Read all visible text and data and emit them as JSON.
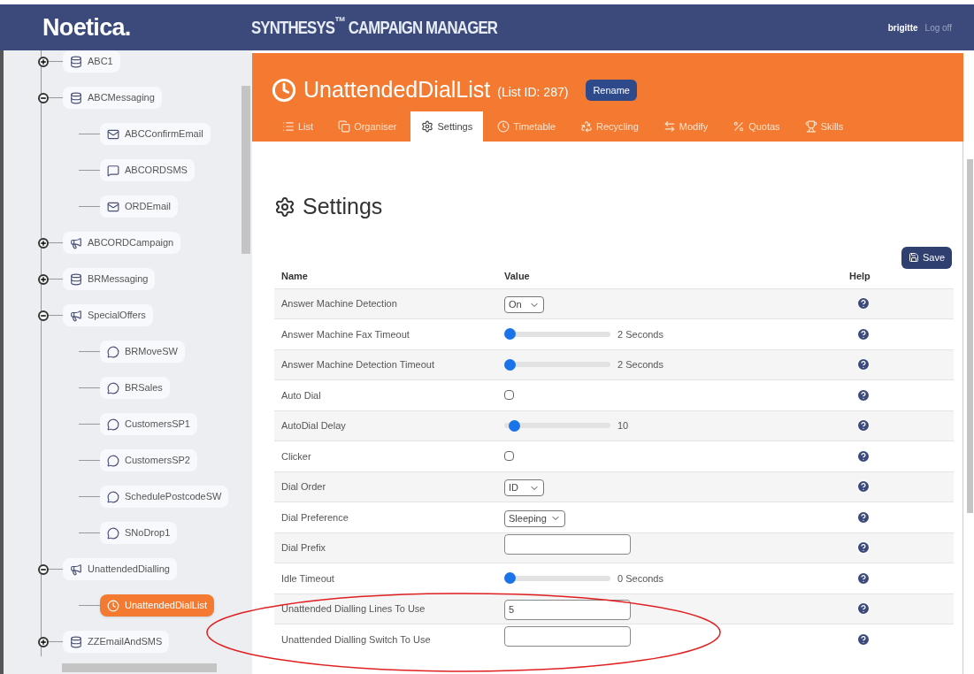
{
  "header": {
    "logo": "Noetica.",
    "product": "SYNTHESYS$^{™}$ CAMPAIGN MANAGER",
    "user": "brigitte",
    "logoff": "Log off"
  },
  "tree": [
    {
      "label": "ABC1",
      "kind": "database",
      "expanded": false,
      "selected": false
    },
    {
      "label": "ABCMessaging",
      "kind": "database",
      "expanded": true,
      "selected": false,
      "children": [
        {
          "label": "ABCConfirmEmail",
          "kind": "email",
          "selected": false
        },
        {
          "label": "ABCORDSMS",
          "kind": "sms",
          "selected": false
        },
        {
          "label": "ORDEmail",
          "kind": "email",
          "selected": false
        }
      ]
    },
    {
      "label": "ABCORDCampaign",
      "kind": "campaign",
      "expanded": false,
      "selected": false
    },
    {
      "label": "BRMessaging",
      "kind": "database",
      "expanded": false,
      "selected": false
    },
    {
      "label": "SpecialOffers",
      "kind": "campaign",
      "expanded": true,
      "selected": false,
      "children": [
        {
          "label": "BRMoveSW",
          "kind": "chat",
          "selected": false
        },
        {
          "label": "BRSales",
          "kind": "chat",
          "selected": false
        },
        {
          "label": "CustomersSP1",
          "kind": "chat",
          "selected": false
        },
        {
          "label": "CustomersSP2",
          "kind": "chat",
          "selected": false
        },
        {
          "label": "SchedulePostcodeSW",
          "kind": "chat",
          "selected": false
        },
        {
          "label": "SNoDrop1",
          "kind": "chat",
          "selected": false
        }
      ]
    },
    {
      "label": "UnattendedDialling",
      "kind": "campaign",
      "expanded": true,
      "selected": false,
      "children": [
        {
          "label": "UnattendedDialList",
          "kind": "dial-list",
          "selected": true
        }
      ]
    },
    {
      "label": "ZZEmailAndSMS",
      "kind": "database",
      "expanded": false,
      "selected": false
    }
  ],
  "list": {
    "title": "UnattendedDialList",
    "id_label": "(List ID: 287)",
    "rename": "Rename"
  },
  "tabs": [
    {
      "label": "List",
      "selected": false
    },
    {
      "label": "Organiser",
      "selected": false
    },
    {
      "label": "Settings",
      "selected": true
    },
    {
      "label": "Timetable",
      "selected": false
    },
    {
      "label": "Recycling",
      "selected": false
    },
    {
      "label": "Modify",
      "selected": false
    },
    {
      "label": "Quotas",
      "selected": false
    },
    {
      "label": "Skills",
      "selected": false
    }
  ],
  "page_title": "Settings",
  "save": "Save",
  "table": {
    "columns": [
      "Name",
      "Value",
      "Help"
    ],
    "rows": [
      {
        "name": "Answer Machine Detection",
        "kind": "select",
        "value": "On"
      },
      {
        "name": "Answer Machine Fax Timeout",
        "kind": "slider",
        "level": 0,
        "reading": "2 Seconds"
      },
      {
        "name": "Answer Machine Detection Timeout",
        "kind": "slider",
        "level": 0,
        "reading": "2 Seconds"
      },
      {
        "name": "Auto Dial",
        "kind": "checkbox",
        "checked": false
      },
      {
        "name": "AutoDial Delay",
        "kind": "slider",
        "level": 0.05,
        "reading": "10"
      },
      {
        "name": "Clicker",
        "kind": "checkbox",
        "checked": false
      },
      {
        "name": "Dial Order",
        "kind": "select",
        "value": "ID"
      },
      {
        "name": "Dial Preference",
        "kind": "select",
        "value": "Sleeping"
      },
      {
        "name": "Dial Prefix",
        "kind": "text"
      },
      {
        "name": "Idle Timeout",
        "kind": "slider",
        "level": 0,
        "reading": "0 Seconds"
      },
      {
        "name": "Unattended Dialling Lines To Use",
        "kind": "text",
        "value": "5"
      },
      {
        "name": "Unattended Dialling Switch To Use",
        "kind": "text"
      }
    ]
  }
}
